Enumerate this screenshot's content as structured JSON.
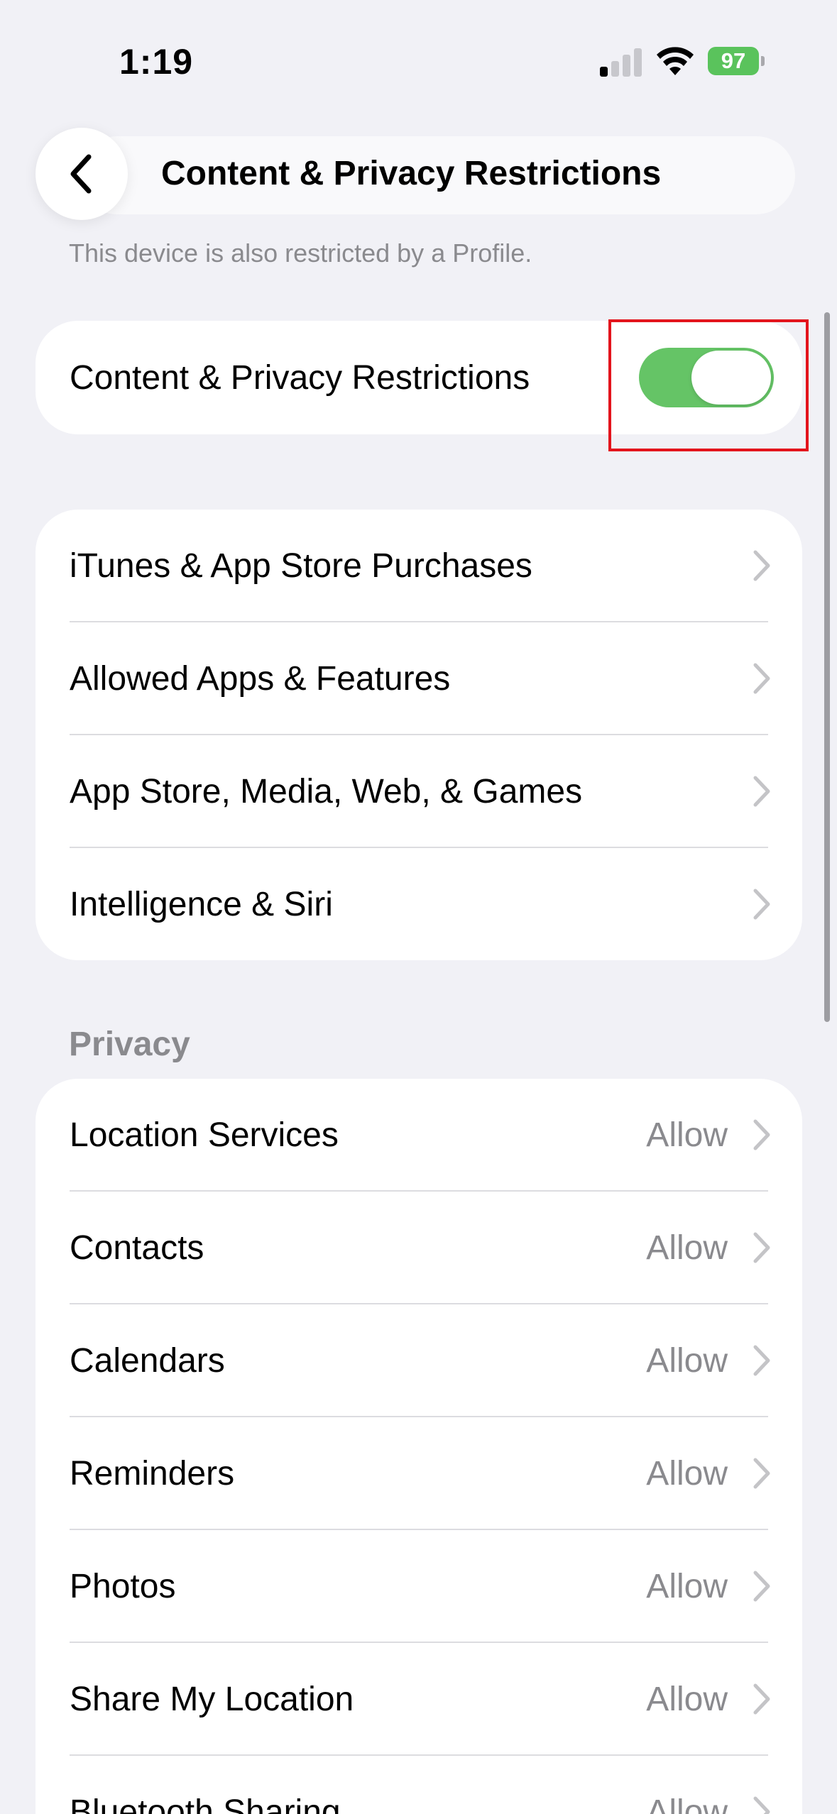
{
  "status_bar": {
    "time": "1:19",
    "battery": "97"
  },
  "nav": {
    "title": "Content & Privacy Restrictions"
  },
  "profile_note": "This device is also restricted by a Profile.",
  "master_toggle": {
    "label": "Content & Privacy Restrictions",
    "state": "on",
    "color": "#65c466"
  },
  "menu_items": [
    "iTunes & App Store Purchases",
    "Allowed Apps & Features",
    "App Store, Media, Web, & Games",
    "Intelligence & Siri"
  ],
  "privacy": {
    "header": "Privacy",
    "items": [
      {
        "label": "Location Services",
        "value": "Allow"
      },
      {
        "label": "Contacts",
        "value": "Allow"
      },
      {
        "label": "Calendars",
        "value": "Allow"
      },
      {
        "label": "Reminders",
        "value": "Allow"
      },
      {
        "label": "Photos",
        "value": "Allow"
      },
      {
        "label": "Share My Location",
        "value": "Allow"
      },
      {
        "label": "Bluetooth Sharing",
        "value": "Allow"
      }
    ]
  },
  "highlight_color": "#e3141c"
}
